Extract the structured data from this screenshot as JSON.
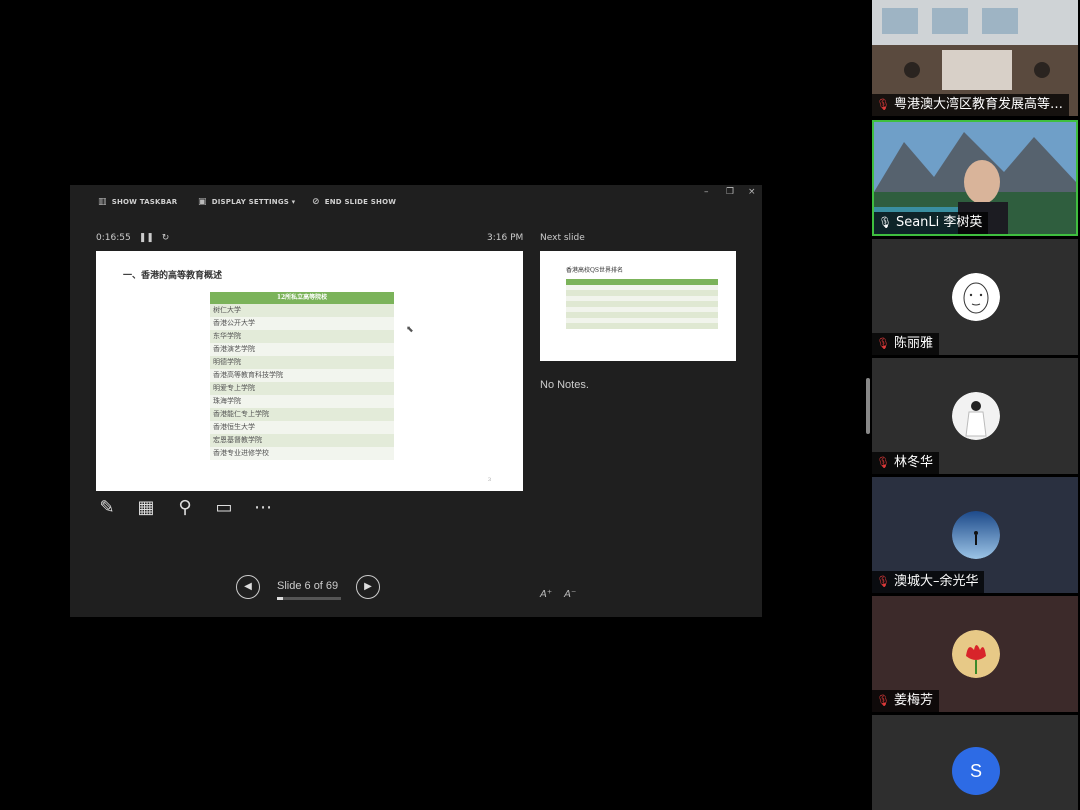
{
  "toolbar": {
    "show_taskbar": "SHOW TASKBAR",
    "display_settings": "DISPLAY SETTINGS ▾",
    "end_slide_show": "END SLIDE SHOW"
  },
  "window_controls": {
    "minimize": "–",
    "restore": "❐",
    "close": "×"
  },
  "presenter": {
    "elapsed": "0:16:55",
    "clock": "3:16 PM",
    "next_label": "Next slide",
    "notes": "No Notes.",
    "slide_position": "Slide 6 of 69"
  },
  "current_slide": {
    "title": "一、香港的高等教育概述",
    "table_header": "12所私立高等院校",
    "rows": [
      "树仁大学",
      "香港公开大学",
      "东华学院",
      "香港演艺学院",
      "明德学院",
      "香港高等教育科技学院",
      "明爱专上学院",
      "珠海学院",
      "香港能仁专上学院",
      "香港恒生大学",
      "宏恩基督教学院",
      "香港专业进修学校"
    ],
    "page": "3"
  },
  "next_slide": {
    "title": "香港高校QS世界排名"
  },
  "participants": [
    {
      "name": "粤港澳大湾区教育发展高等…",
      "muted": true
    },
    {
      "name": "SeanLi 李树英",
      "muted": false
    },
    {
      "name": "陈丽雅",
      "muted": true
    },
    {
      "name": "林冬华",
      "muted": true
    },
    {
      "name": "澳城大–余光华",
      "muted": true
    },
    {
      "name": "姜梅芳",
      "muted": true
    },
    {
      "initial": "S"
    }
  ],
  "colors": {
    "active_speaker": "#3fbf3f",
    "slide_table_header": "#7bb35a",
    "avatar_blue": "#2d6be5",
    "muted_mic": "#e03a3a"
  }
}
